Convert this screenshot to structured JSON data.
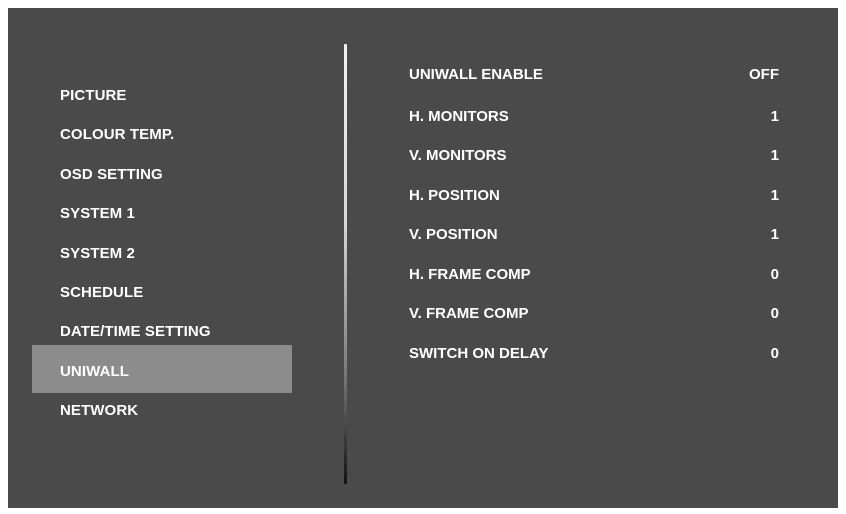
{
  "menu": {
    "items": [
      {
        "label": "PICTURE"
      },
      {
        "label": "COLOUR TEMP."
      },
      {
        "label": "OSD SETTING"
      },
      {
        "label": "SYSTEM 1"
      },
      {
        "label": "SYSTEM 2"
      },
      {
        "label": "SCHEDULE"
      },
      {
        "label": "DATE/TIME SETTING"
      },
      {
        "label": "UNIWALL"
      },
      {
        "label": "NETWORK"
      }
    ],
    "selected": "UNIWALL"
  },
  "settings": {
    "rows": [
      {
        "label": "UNIWALL ENABLE",
        "value": "OFF"
      },
      {
        "label": "H. MONITORS",
        "value": "1"
      },
      {
        "label": "V. MONITORS",
        "value": "1"
      },
      {
        "label": "H. POSITION",
        "value": "1"
      },
      {
        "label": "V. POSITION",
        "value": "1"
      },
      {
        "label": "H. FRAME COMP",
        "value": "0"
      },
      {
        "label": "V. FRAME COMP",
        "value": "0"
      },
      {
        "label": "SWITCH ON DELAY",
        "value": "0"
      }
    ]
  },
  "colors": {
    "background": "#4a4a4a",
    "selected_highlight": "#8c8c8c",
    "text": "#ffffff"
  }
}
